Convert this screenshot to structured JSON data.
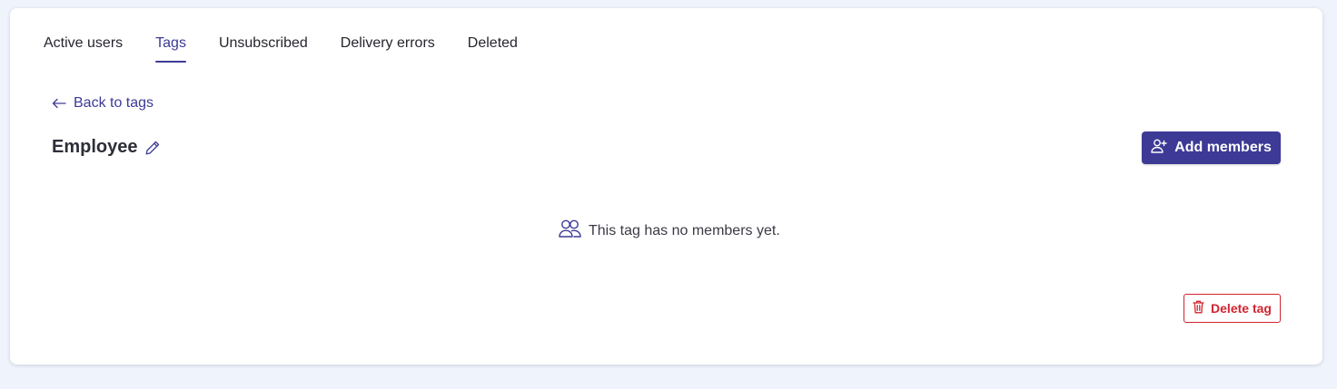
{
  "tabs": [
    {
      "label": "Active users",
      "active": false
    },
    {
      "label": "Tags",
      "active": true
    },
    {
      "label": "Unsubscribed",
      "active": false
    },
    {
      "label": "Delivery errors",
      "active": false
    },
    {
      "label": "Deleted",
      "active": false
    }
  ],
  "back_link": {
    "label": "Back to tags",
    "icon": "arrow-left-icon"
  },
  "tag": {
    "name": "Employee",
    "edit_icon": "pencil-icon"
  },
  "add_members": {
    "label": "Add members",
    "icon": "user-plus-icon"
  },
  "empty_state": {
    "message": "This tag has no members yet.",
    "icon": "users-icon"
  },
  "delete_tag": {
    "label": "Delete tag",
    "icon": "trash-icon"
  },
  "colors": {
    "accent": "#3d3a96",
    "danger": "#d1242f",
    "background": "#eff3fb",
    "card": "#ffffff"
  }
}
